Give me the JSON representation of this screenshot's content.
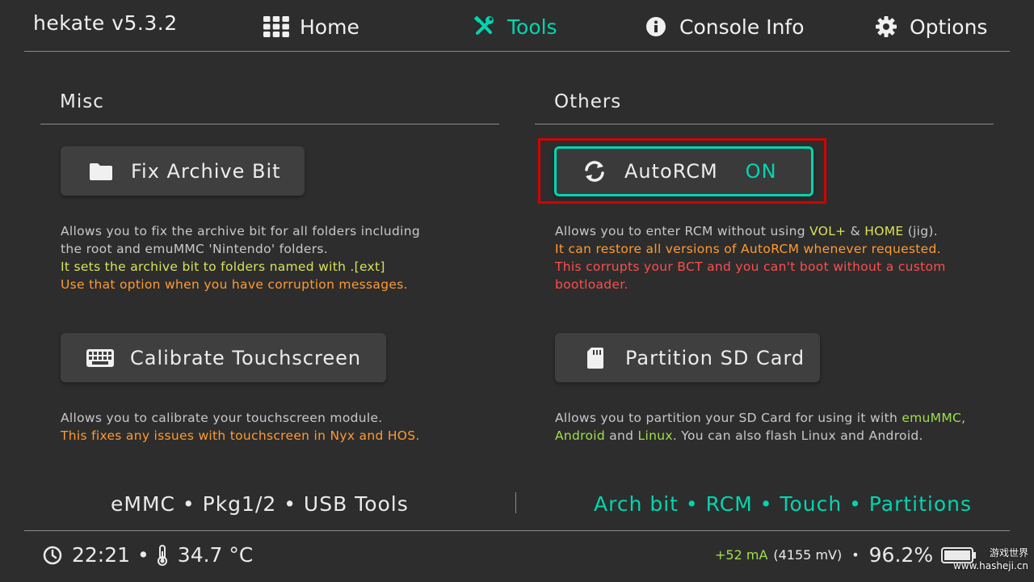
{
  "header": {
    "app_title": "hekate v5.3.2",
    "nav": [
      {
        "label": "Home",
        "icon": "grid-icon",
        "active": false
      },
      {
        "label": "Tools",
        "icon": "wrench-screwdriver-icon",
        "active": true
      },
      {
        "label": "Console Info",
        "icon": "info-circle-icon",
        "active": false
      },
      {
        "label": "Options",
        "icon": "gear-icon",
        "active": false
      }
    ]
  },
  "misc": {
    "title": "Misc",
    "fix_archive": {
      "label": "Fix Archive Bit",
      "icon": "folder-icon",
      "desc_lines": [
        "Allows you to fix the archive bit for all folders including",
        "the root and emuMMC 'Nintendo' folders.",
        "It sets the archive bit to folders named with .[ext]",
        "Use that option when you have corruption messages."
      ]
    },
    "calibrate": {
      "label": "Calibrate Touchscreen",
      "icon": "keyboard-icon",
      "desc_lines": [
        "Allows you to calibrate your touchscreen module.",
        "This fixes any issues with touchscreen in Nyx and HOS."
      ]
    }
  },
  "others": {
    "title": "Others",
    "autorcm": {
      "label": "AutoRCM",
      "state": "ON",
      "icon": "refresh-icon",
      "desc_1a": "Allows you to enter RCM without using ",
      "desc_1b": "VOL+",
      "desc_1c": " & ",
      "desc_1d": "HOME",
      "desc_1e": " (jig).",
      "desc_2": "It can restore all versions of AutoRCM whenever requested.",
      "desc_3": "This corrupts your BCT and you can't boot without a custom",
      "desc_4": "bootloader."
    },
    "partition": {
      "label": "Partition SD Card",
      "icon": "sd-card-icon",
      "desc_1a": "Allows you to partition your SD Card for using it with ",
      "desc_1b": "emuMMC",
      "desc_1c": ",",
      "desc_2a": "Android",
      "desc_2b": " and ",
      "desc_2c": "Linux",
      "desc_2d": ". You can also flash Linux and Android."
    }
  },
  "footer": {
    "left_links": "eMMC • Pkg1/2 • USB Tools",
    "right_links": "Arch bit • RCM • Touch • Partitions",
    "time": "22:21",
    "bullet": "•",
    "temperature": "34.7 °C",
    "current": "+52 mA",
    "voltage": "(4155 mV)",
    "battery_percent": "96.2%",
    "watermark": "游戏世界 www.hasheji.cn"
  },
  "colors": {
    "accent": "#00d6b0",
    "highlight_frame": "#d40000",
    "yellow": "#d8e35a",
    "orange": "#ff9a32",
    "red": "#ff4d4d",
    "green": "#9fe04a"
  }
}
